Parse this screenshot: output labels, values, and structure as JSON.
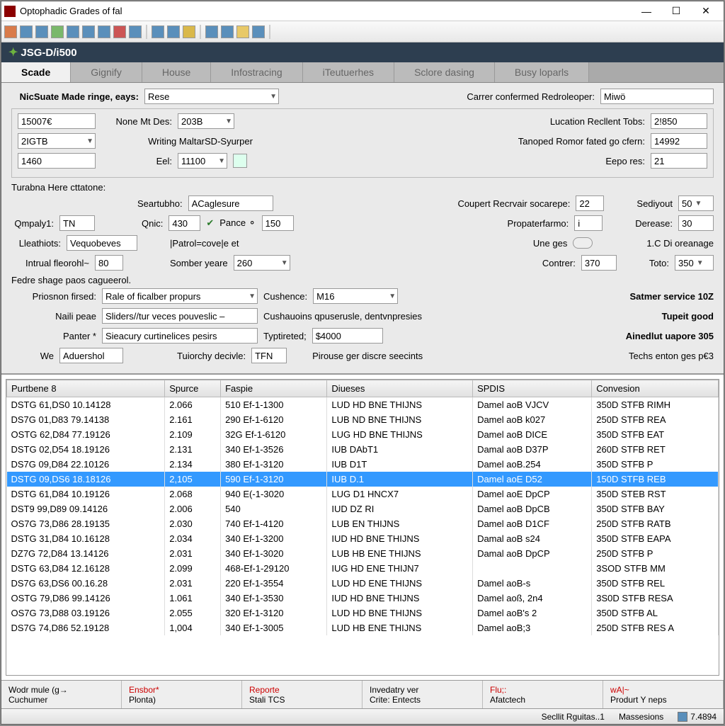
{
  "window": {
    "title": "Optophadic Grades of fal"
  },
  "header": {
    "code": "JSG-D/i500"
  },
  "tabs": [
    "Scade",
    "Gignify",
    "House",
    "Infostracing",
    "iTeutuerhes",
    "Sclore dasing",
    "Busy loparls"
  ],
  "form": {
    "row1": {
      "label1": "NicSuate Made ringe, eays:",
      "val1": "Rese",
      "label2": "Carrer confermed Redroleoper:",
      "val2": "Miwö"
    },
    "row2": {
      "val_a": "15007€",
      "label_b": "None Mt Des:",
      "val_b": "203B",
      "label_c": "Lucation Recllent Tobs:",
      "val_c": "2!850"
    },
    "row3": {
      "val_a": "2IGTB",
      "label_b": "Writing MaltarSD-Syurper",
      "label_c": "Tanoped Romor fated go cfern:",
      "val_c": "14992"
    },
    "row4": {
      "val_a": "1460",
      "label_b": "Eel:",
      "val_b": "11100",
      "label_c": "Eepo res:",
      "val_c": "21"
    },
    "group1_label": "Turabna Here cttatone:",
    "g1": {
      "r1": {
        "l1": "Seartubho:",
        "v1": "ACaglesure",
        "l2": "Coupert Recrvair socarepe:",
        "v2": "22",
        "l3": "Sediyout",
        "v3": "50"
      },
      "r2": {
        "l0": "Qmpaly1:",
        "v0": "TN",
        "l1": "Qnic:",
        "v1": "430",
        "l2": "Pance ⚬",
        "v2": "150",
        "l3": "Propaterfarmo:",
        "v3": "i",
        "l4": "Derease:",
        "v4": "30"
      },
      "r3": {
        "l0": "Lleathiots:",
        "v0": "Vequobeves",
        "l1": "|Patrol=cove|e et",
        "l2": "Une ges",
        "l3": "1.C Di oreanage"
      },
      "r4": {
        "l0": "Intrual fleorohl~",
        "v0": "80",
        "l1": "Somber yeare",
        "v1": "260",
        "l2": "Contrer:",
        "v2": "370",
        "l3": "Toto:",
        "v3": "350"
      }
    },
    "group2_label": "Fedre shage paos cagueerol.",
    "g2": {
      "r1": {
        "l0": "Priosnon firsed:",
        "v0": "Rale of ficalber propurs",
        "l1": "Cushence:",
        "v1": "M16",
        "l2": "Satmer service 10Z"
      },
      "r2": {
        "l0": "Naili peae",
        "v0": "Sliders//tur veces pouveslic –",
        "l1": "Cushauoins qpuserusle, dentvnpresies",
        "l2": "Tupeit good"
      },
      "r3": {
        "l0": "Panter *",
        "v0": "Sieacury curtinelices pesirs",
        "l1": "Typtireted;",
        "v1": "$4000",
        "l2": "Ainedlut uapore 305"
      },
      "r4": {
        "l0": "We",
        "v0": "Aduershol",
        "l1": "Tuiorchy decivle:",
        "v1": "TFN",
        "l2": "Pirouse ger discre seecints",
        "l3": "Techs enton ges p€3"
      }
    }
  },
  "table": {
    "headers": [
      "Purtbene 8",
      "Spurce",
      "Faspie",
      "Diueses",
      "SPDIS",
      "Convesion"
    ],
    "rows": [
      [
        "DSTG 61,DS0 10.14128",
        "2.066",
        "510 Ef-1-1300",
        "LUD HD BNE THIJNS",
        "Damel aoB VJCV",
        "350D STFB RIMH"
      ],
      [
        "DS7G 01,D83 79.14138",
        "2.161",
        "290 Ef-1-6120",
        "LUB ND BNE THIJNS",
        "Damel aoB k027",
        "250D STFB REA"
      ],
      [
        "OSTG 62,D84 77.19126",
        "2.109",
        "32G Ef-1-6120",
        "LUG HD BNE THIJNS",
        "Damel aoB DICE",
        "350D STFB EAT"
      ],
      [
        "DSTG 02,D54 18.19126",
        "2.131",
        "340 Ef-1-3526",
        "IUB DAbT1",
        "Damal aoB D37P",
        "260D STFB RET"
      ],
      [
        "DS7G 09,D84 22.10126",
        "2.134",
        "380 Ef-1-3120",
        "IUB D1T",
        "Damel aoB.254",
        "350D STFB P"
      ],
      [
        "DSTG 09,DS6 18.18126",
        "2,105",
        "590 Ef-1-3120",
        "IUB D.1",
        "Damel aoE D52",
        "150D STFB REB"
      ],
      [
        "DSTG 61,D84 10.19126",
        "2.068",
        "940 E(-1-3020",
        "LUG D1 HNCX7",
        "Damel aoE DpCP",
        "350D STEB RST"
      ],
      [
        "DST9 99,D89 09.14126",
        "2.006",
        "540",
        "IUD DZ RI",
        "Damel aoB DpCB",
        "350D STFB BAY"
      ],
      [
        "OS7G 73,D86 28.19135",
        "2.030",
        "740 Ef-1-4120",
        "LUB EN THIJNS",
        "Damel aoB D1CF",
        "250D STFB RATB"
      ],
      [
        "DSTG 31,D84 10.16128",
        "2.034",
        "340 Ef-1-3200",
        "IUD HD BNE THIJNS",
        "Damal aoB s24",
        "350D STFB EAPA"
      ],
      [
        "DZ7G 72,D84 13.14126",
        "2.031",
        "340 Ef-1-3020",
        "LUB HB ENE THIJNS",
        "Damal aoB DpCP",
        "250D STFB P"
      ],
      [
        "DSTG 63,D84 12.16128",
        "2.099",
        "468-Ef-1-29120",
        "IUG HD ENE THIJN7",
        "",
        "3SOD STFB MM"
      ],
      [
        "DS7G 63,DS6 00.16.28",
        "2.031",
        "220 Ef-1-3554",
        "LUD HD ENE THIJNS",
        "Damel aoB-s",
        "350D STFB REL"
      ],
      [
        "OSTG 79,D86 99.14126",
        "1.061",
        "340 Ef-1-3530",
        "IUD HD BNE THIJNS",
        "Damel aoß, 2n4",
        "3S0D STFB RESA"
      ],
      [
        "OS7G 73,D88 03.19126",
        "2.055",
        "320 Ef-1-3120",
        "LUD HD BNE THIJNS",
        "Damel aoB's 2",
        "350D STFB AL"
      ],
      [
        "DS7G 74,D86 52.19128",
        "1,004",
        "340 Ef-1-3005",
        "LUD HB ENE THIJNS",
        "Damel aoB;3",
        "250D STFB RES A"
      ]
    ],
    "selected_index": 5
  },
  "footer_tabs": [
    {
      "top": "Wodr mule (g→",
      "bottom": "Cuchumer"
    },
    {
      "top": "Ensbor*",
      "bottom": "Plonta)"
    },
    {
      "top": "Reporte",
      "bottom": "Stali TCS"
    },
    {
      "top": "Invedatry ver",
      "bottom": "Crite:   Entects"
    },
    {
      "top": "Flu;:",
      "bottom": "Afatctech"
    },
    {
      "top": "wA|~",
      "bottom": "Produrt Y neps"
    }
  ],
  "status": {
    "item1": "Secllit Rguitas..1",
    "item2": "Massesions",
    "item3": "7.4894"
  }
}
